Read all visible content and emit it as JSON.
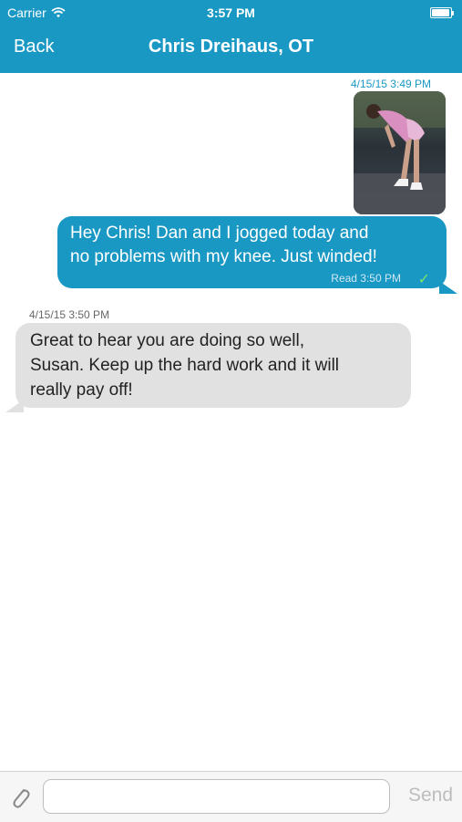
{
  "status_bar": {
    "carrier": "Carrier",
    "time": "3:57 PM",
    "icons": [
      "wifi-icon",
      "battery-icon"
    ]
  },
  "nav": {
    "back_label": "Back",
    "title": "Chris Dreihaus, OT"
  },
  "colors": {
    "accent": "#1a98c4",
    "incoming_bubble": "#e1e1e1",
    "read_check": "#7ee36d"
  },
  "messages": [
    {
      "direction": "outgoing",
      "timestamp": "4/15/15  3:49 PM",
      "attachment": "photo",
      "text": "Hey Chris!  Dan and I jogged today and\nno problems with my knee. Just winded!",
      "receipt": "Read 3:50 PM",
      "receipt_icon": "check-icon"
    },
    {
      "direction": "incoming",
      "timestamp": "4/15/15  3:50 PM",
      "text": "Great to hear you are doing so well,\nSusan. Keep up the hard work and it will\nreally pay off!"
    }
  ],
  "composer": {
    "input_value": "",
    "placeholder": "",
    "send_label": "Send",
    "attach_icon": "paperclip-icon"
  }
}
